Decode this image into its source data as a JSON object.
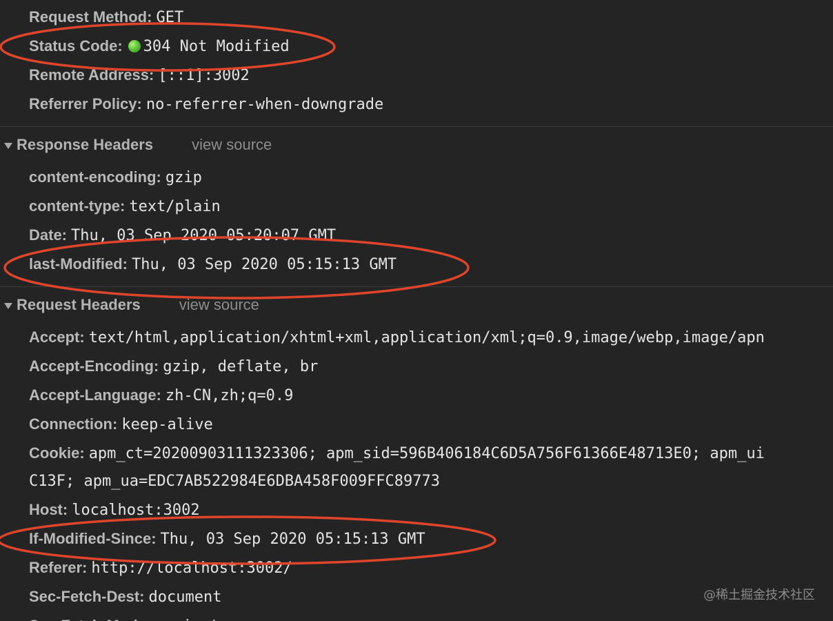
{
  "general": {
    "rows": [
      {
        "key": "Request Method:",
        "value": "GET"
      },
      {
        "key": "Status Code:",
        "value": "304 Not Modified"
      },
      {
        "key": "Remote Address:",
        "value": "[::1]:3002"
      },
      {
        "key": "Referrer Policy:",
        "value": "no-referrer-when-downgrade"
      }
    ],
    "status_color": "#5fc63a"
  },
  "response_headers": {
    "title": "Response Headers",
    "view_source": "view source",
    "rows": [
      {
        "key": "content-encoding:",
        "value": "gzip"
      },
      {
        "key": "content-type:",
        "value": "text/plain"
      },
      {
        "key": "Date:",
        "value": "Thu, 03 Sep 2020 05:20:07 GMT"
      },
      {
        "key": "last-Modified:",
        "value": "Thu, 03 Sep 2020 05:15:13 GMT"
      }
    ]
  },
  "request_headers": {
    "title": "Request Headers",
    "view_source": "view source",
    "rows": [
      {
        "key": "Accept:",
        "value": "text/html,application/xhtml+xml,application/xml;q=0.9,image/webp,image/apn"
      },
      {
        "key": "Accept-Encoding:",
        "value": "gzip, deflate, br"
      },
      {
        "key": "Accept-Language:",
        "value": "zh-CN,zh;q=0.9"
      },
      {
        "key": "Connection:",
        "value": "keep-alive"
      },
      {
        "key": "Cookie:",
        "value": "apm_ct=20200903111323306; apm_sid=596B406184C6D5A756F61366E48713E0; apm_ui"
      },
      {
        "key": "",
        "value": "C13F; apm_ua=EDC7AB522984E6DBA458F009FFC89773"
      },
      {
        "key": "Host:",
        "value": "localhost:3002"
      },
      {
        "key": "If-Modified-Since:",
        "value": "Thu, 03 Sep 2020 05:15:13 GMT"
      },
      {
        "key": "Referer:",
        "value": "http://localhost:3002/"
      },
      {
        "key": "Sec-Fetch-Dest:",
        "value": "document"
      },
      {
        "key": "Sec-Fetch-Mode:",
        "value": "navigate"
      }
    ]
  },
  "annotation_color": "#e0452c",
  "watermark": "@稀土掘金技术社区"
}
